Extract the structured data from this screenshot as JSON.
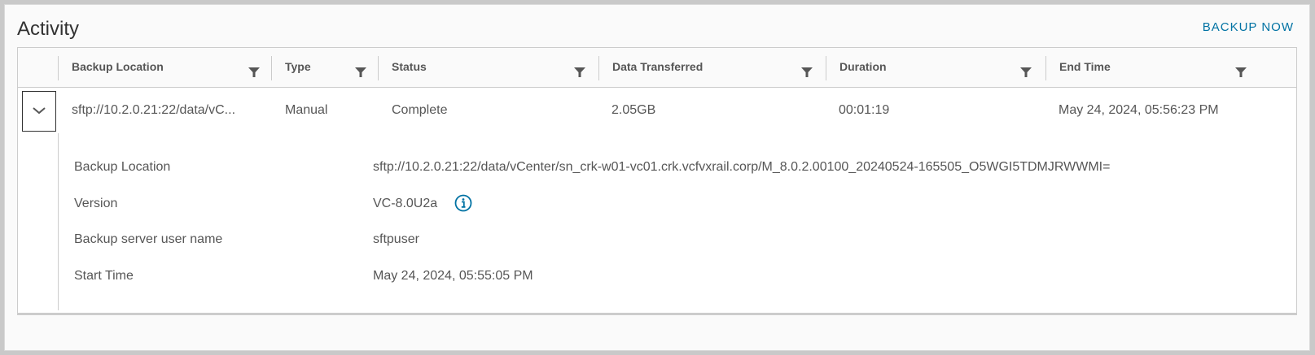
{
  "header": {
    "title": "Activity",
    "backup_now_label": "BACKUP NOW"
  },
  "columns": [
    {
      "label": "Backup Location"
    },
    {
      "label": "Type"
    },
    {
      "label": "Status"
    },
    {
      "label": "Data Transferred"
    },
    {
      "label": "Duration"
    },
    {
      "label": "End Time"
    }
  ],
  "row": {
    "backup_location": "sftp://10.2.0.21:22/data/vC...",
    "type": "Manual",
    "status": "Complete",
    "data_transferred": "2.05GB",
    "duration": "00:01:19",
    "end_time": "May 24, 2024, 05:56:23 PM"
  },
  "details": [
    {
      "label": "Backup Location",
      "value": "sftp://10.2.0.21:22/data/vCenter/sn_crk-w01-vc01.crk.vcfvxrail.corp/M_8.0.2.00100_20240524-165505_O5WGI5TDMJRWWMI="
    },
    {
      "label": "Version",
      "value": "VC-8.0U2a"
    },
    {
      "label": "Backup server user name",
      "value": "sftpuser"
    },
    {
      "label": "Start Time",
      "value": "May 24, 2024, 05:55:05 PM"
    }
  ],
  "colors": {
    "accent": "#0072a3",
    "text": "#565656",
    "border": "#cccccc"
  },
  "icons": [
    "filter-icon",
    "chevron-down-icon",
    "info-icon"
  ]
}
